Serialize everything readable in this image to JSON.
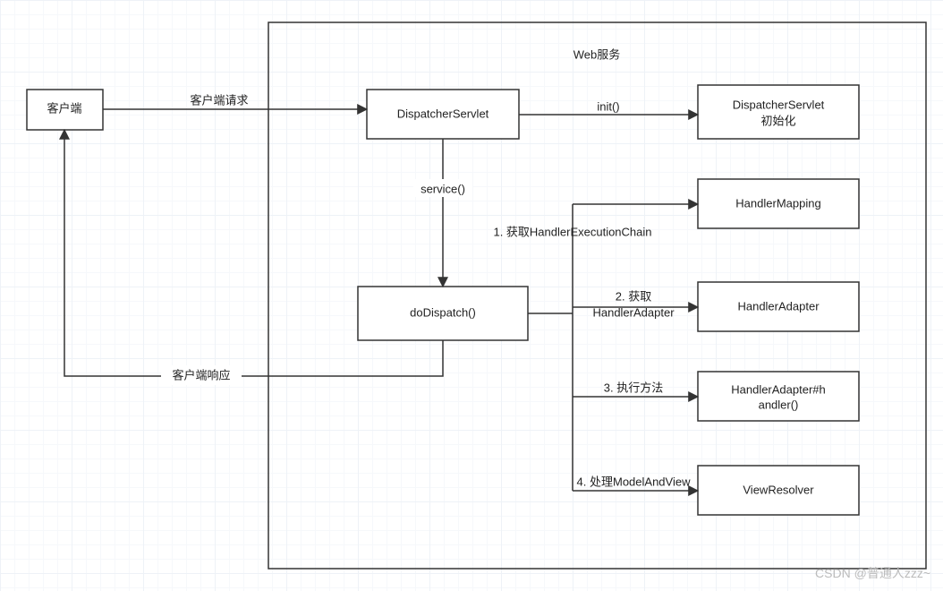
{
  "container": {
    "title": "Web服务"
  },
  "nodes": {
    "client": "客户端",
    "dispatcher": "DispatcherServlet",
    "init": [
      "DispatcherServlet",
      "初始化"
    ],
    "doDispatch": "doDispatch()",
    "handlerMapping": "HandlerMapping",
    "handlerAdapter": "HandlerAdapter",
    "handlerMethod": [
      "HandlerAdapter#h",
      "andler()"
    ],
    "viewResolver": "ViewResolver"
  },
  "edges": {
    "clientRequest": "客户端请求",
    "clientResponse": "客户端响应",
    "initCall": "init()",
    "serviceCall": "service()",
    "step1": "1. 获取HandlerExecutionChain",
    "step2a": "2. 获取",
    "step2b": "HandlerAdapter",
    "step3": "3. 执行方法",
    "step4": "4. 处理ModelAndView"
  },
  "watermark": "CSDN @普通人zzz~"
}
